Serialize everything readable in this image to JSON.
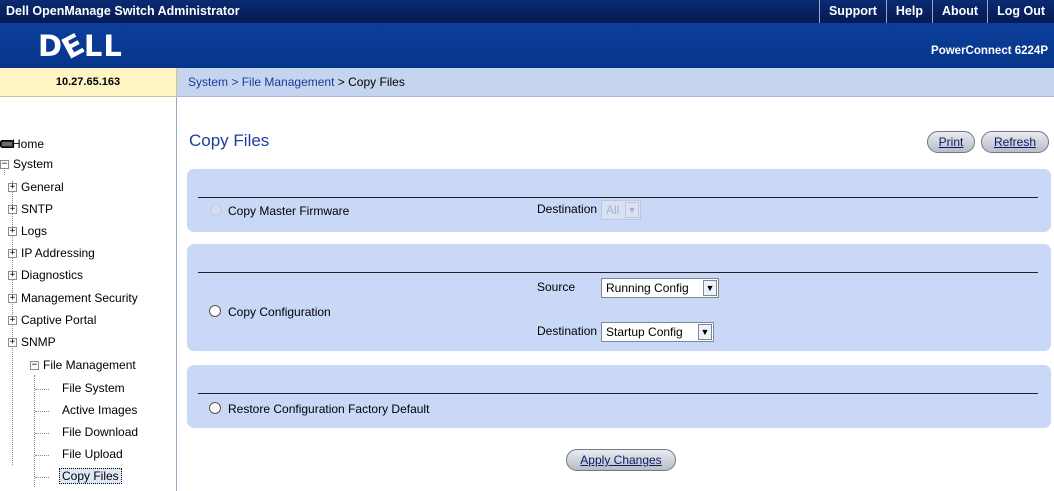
{
  "app": {
    "title": "Dell OpenManage Switch Administrator",
    "links": [
      "Support",
      "Help",
      "About",
      "Log Out"
    ],
    "logo_text": "DϵLL",
    "model": "PowerConnect 6224P"
  },
  "ip_address": "10.27.65.163",
  "breadcrumb": {
    "items": [
      "System",
      "File Management"
    ],
    "current": "Copy Files",
    "separator": ">"
  },
  "nav": {
    "home": "Home",
    "system": "System",
    "system_children": [
      "General",
      "SNTP",
      "Logs",
      "IP Addressing",
      "Diagnostics",
      "Management Security",
      "Captive Portal",
      "SNMP",
      "File Management"
    ],
    "file_management_children": [
      "File System",
      "Active Images",
      "File Download",
      "File Upload",
      "Copy Files"
    ],
    "selected": "Copy Files"
  },
  "page": {
    "title": "Copy Files",
    "print_label": "Print",
    "refresh_label": "Refresh",
    "apply_label": "Apply Changes"
  },
  "sections": {
    "firmware": {
      "label": "Copy Master Firmware",
      "destination_label": "Destination",
      "destination_value": "All",
      "enabled": false
    },
    "configuration": {
      "label": "Copy Configuration",
      "source_label": "Source",
      "source_value": "Running Config",
      "destination_label": "Destination",
      "destination_value": "Startup Config"
    },
    "restore": {
      "label": "Restore Configuration Factory Default"
    }
  },
  "colors": {
    "topbar": "#041a52",
    "banner": "#0b3f9b",
    "panel": "#c9d8f6",
    "title": "#1c3d9e"
  }
}
